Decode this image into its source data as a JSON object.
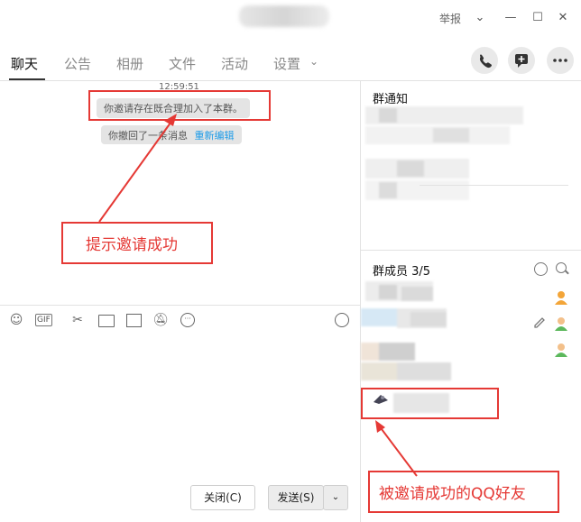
{
  "titlebar": {
    "report_label": "举报",
    "minimize": "—",
    "maximize": "☐",
    "close": "✕"
  },
  "tabs": [
    "聊天",
    "公告",
    "相册",
    "文件",
    "活动",
    "设置"
  ],
  "chat": {
    "timestamp": "12:59:51",
    "system_message": "你邀请存在既合理加入了本群。",
    "recall_message": "你撤回了一条消息",
    "reedit_link": "重新编辑"
  },
  "annotations": {
    "invite_success": "提示邀请成功",
    "invited_friend": "被邀请成功的QQ好友"
  },
  "composer": {
    "close_button": "关闭(C)",
    "send_button": "发送(S)"
  },
  "right_panel": {
    "notice_title": "群通知",
    "members_title": "群成员 3/5"
  },
  "colors": {
    "annotation_red": "#e53935",
    "link_blue": "#1e9ce8"
  }
}
